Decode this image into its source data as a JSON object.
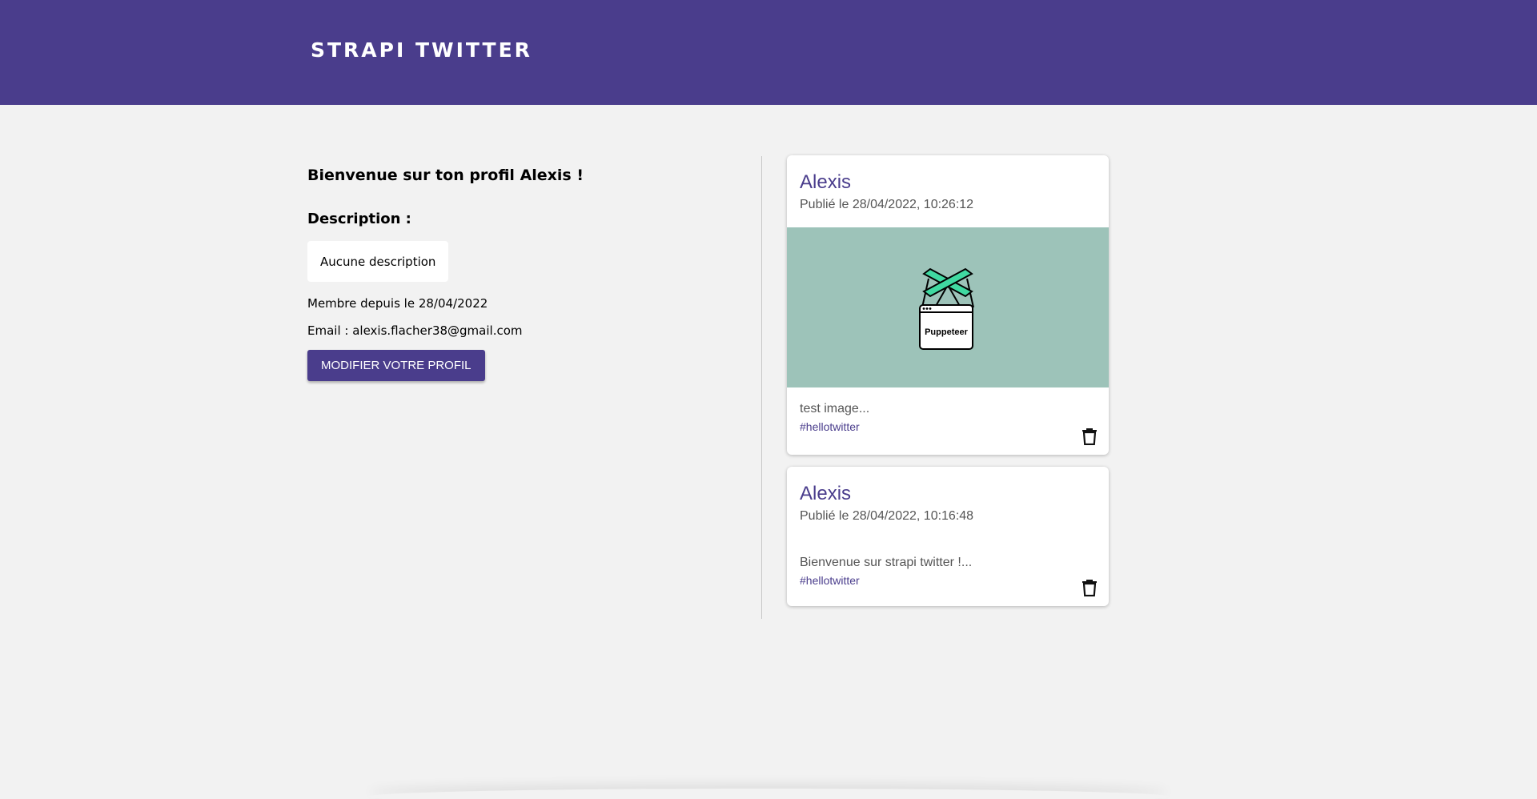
{
  "header": {
    "brand": "STRAPI TWITTER"
  },
  "profile": {
    "welcome": "Bienvenue sur ton profil Alexis !",
    "description_label": "Description :",
    "description_value": "Aucune description",
    "member_since": "Membre depuis le 28/04/2022",
    "email": "Email : alexis.flacher38@gmail.com",
    "edit_button": "MODIFIER VOTRE PROFIL"
  },
  "posts": [
    {
      "author": "Alexis",
      "date": "Publié le 28/04/2022, 10:26:12",
      "image_label": "Puppeteer",
      "text": "test image...",
      "tag": "#hellotwitter"
    },
    {
      "author": "Alexis",
      "date": "Publié le 28/04/2022, 10:16:48",
      "text": "Bienvenue sur strapi twitter !...",
      "tag": "#hellotwitter"
    }
  ],
  "colors": {
    "brand": "#4a3d8c",
    "background": "#f2f2f2",
    "image_bg": "#9dc3b9",
    "puppeteer_green": "#40d9a1"
  },
  "icons": {
    "delete": "trash-icon"
  }
}
